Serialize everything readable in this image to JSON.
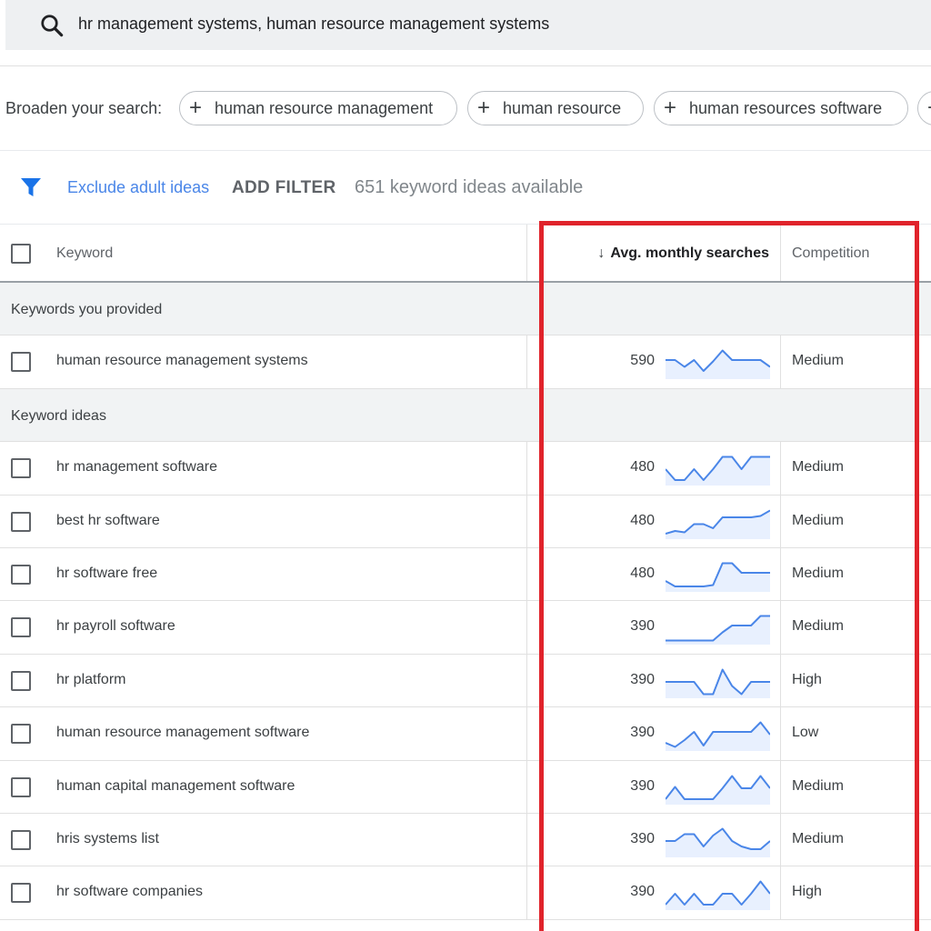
{
  "search": {
    "query": "hr management systems, human resource management systems"
  },
  "broaden": {
    "label": "Broaden your search:",
    "chips": [
      "human resource management",
      "human resource",
      "human resources software"
    ]
  },
  "filters": {
    "exclude_label": "Exclude adult ideas",
    "add_filter_label": "ADD FILTER",
    "available_text": "651 keyword ideas available"
  },
  "table": {
    "headers": {
      "keyword": "Keyword",
      "avg": "Avg. monthly searches",
      "competition": "Competition"
    },
    "group_provided": "Keywords you provided",
    "group_ideas": "Keyword ideas",
    "provided_rows": [
      {
        "keyword": "human resource management systems",
        "searches": "590",
        "competition": "Medium",
        "trend": [
          0.6,
          0.6,
          0.35,
          0.6,
          0.2,
          0.55,
          0.95,
          0.6,
          0.6,
          0.6,
          0.6,
          0.35
        ]
      }
    ],
    "idea_rows": [
      {
        "keyword": "hr management software",
        "searches": "480",
        "competition": "Medium",
        "trend": [
          0.5,
          0.1,
          0.1,
          0.5,
          0.1,
          0.5,
          0.95,
          0.95,
          0.5,
          0.95,
          0.95,
          0.95
        ]
      },
      {
        "keyword": "best hr software",
        "searches": "480",
        "competition": "Medium",
        "trend": [
          0.1,
          0.2,
          0.15,
          0.45,
          0.45,
          0.3,
          0.7,
          0.7,
          0.7,
          0.7,
          0.75,
          0.95
        ]
      },
      {
        "keyword": "hr software free",
        "searches": "480",
        "competition": "Medium",
        "trend": [
          0.3,
          0.1,
          0.1,
          0.1,
          0.1,
          0.15,
          0.95,
          0.95,
          0.6,
          0.6,
          0.6,
          0.6
        ]
      },
      {
        "keyword": "hr payroll software",
        "searches": "390",
        "competition": "Medium",
        "trend": [
          0.05,
          0.05,
          0.05,
          0.05,
          0.05,
          0.05,
          0.35,
          0.6,
          0.6,
          0.6,
          0.95,
          0.95
        ]
      },
      {
        "keyword": "hr platform",
        "searches": "390",
        "competition": "High",
        "trend": [
          0.5,
          0.5,
          0.5,
          0.5,
          0.05,
          0.05,
          0.95,
          0.35,
          0.05,
          0.5,
          0.5,
          0.5
        ]
      },
      {
        "keyword": "human resource management software",
        "searches": "390",
        "competition": "Low",
        "trend": [
          0.2,
          0.05,
          0.3,
          0.6,
          0.1,
          0.6,
          0.6,
          0.6,
          0.6,
          0.6,
          0.95,
          0.5
        ]
      },
      {
        "keyword": "human capital management software",
        "searches": "390",
        "competition": "Medium",
        "trend": [
          0.1,
          0.55,
          0.1,
          0.1,
          0.1,
          0.1,
          0.5,
          0.95,
          0.5,
          0.5,
          0.95,
          0.5
        ]
      },
      {
        "keyword": "hris systems list",
        "searches": "390",
        "competition": "Medium",
        "trend": [
          0.5,
          0.5,
          0.75,
          0.75,
          0.3,
          0.7,
          0.95,
          0.5,
          0.3,
          0.2,
          0.2,
          0.5
        ]
      },
      {
        "keyword": "hr software companies",
        "searches": "390",
        "competition": "High",
        "trend": [
          0.1,
          0.5,
          0.1,
          0.5,
          0.1,
          0.1,
          0.5,
          0.5,
          0.1,
          0.5,
          0.95,
          0.5
        ]
      }
    ]
  },
  "colors": {
    "spark_line": "#4a86e8",
    "spark_fill": "#e8f0fe",
    "highlight": "#e0232b",
    "link": "#4a86e8"
  },
  "icons": {
    "search": "search-icon",
    "filter": "filter-icon",
    "add": "plus-icon",
    "sort": "arrow-down-icon"
  }
}
